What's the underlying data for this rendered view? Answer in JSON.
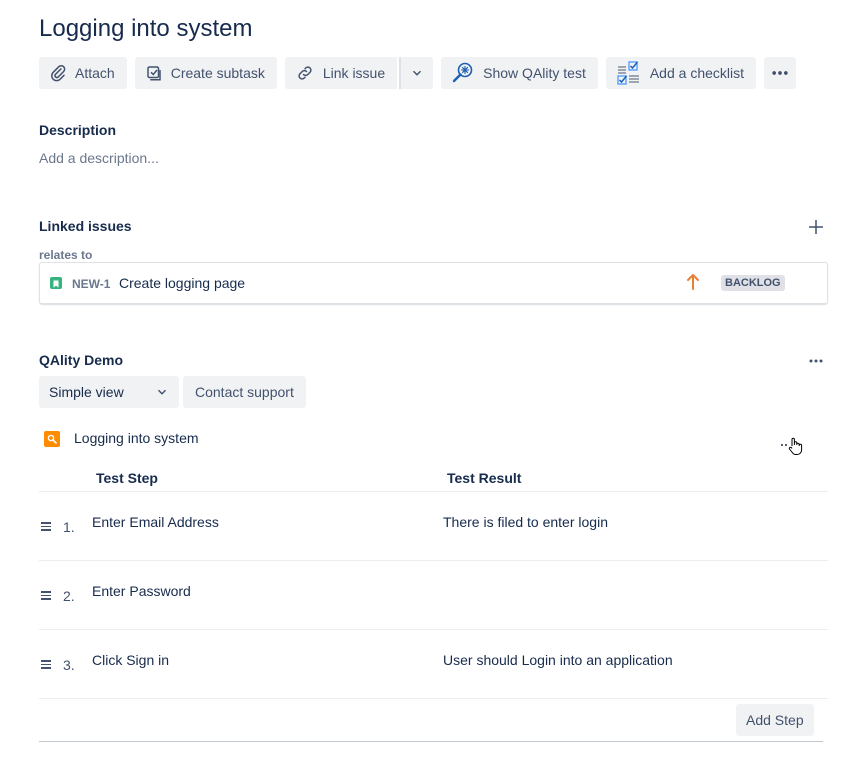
{
  "issue": {
    "title": "Logging into system"
  },
  "toolbar": {
    "attach": "Attach",
    "create_subtask": "Create subtask",
    "link_issue": "Link issue",
    "show_qality": "Show QAlity test",
    "add_checklist": "Add a checklist"
  },
  "description": {
    "label": "Description",
    "placeholder": "Add a description..."
  },
  "linked_issues": {
    "label": "Linked issues",
    "relation": "relates to",
    "items": [
      {
        "key": "NEW-1",
        "summary": "Create logging page",
        "status": "BACKLOG",
        "priority_color": "#ff7452"
      }
    ]
  },
  "qality": {
    "title": "QAlity Demo",
    "view_select": "Simple view",
    "contact_support": "Contact support",
    "test_name": "Logging into system",
    "columns": {
      "step": "Test Step",
      "result": "Test Result"
    },
    "steps": [
      {
        "num": "1.",
        "step": "Enter Email Address",
        "result": "There is filed to enter login"
      },
      {
        "num": "2.",
        "step": "Enter Password",
        "result": ""
      },
      {
        "num": "3.",
        "step": "Click Sign in",
        "result": "User should Login into an application"
      }
    ],
    "add_step": "Add Step"
  },
  "colors": {
    "accent_orange": "#ff8b00",
    "story_green": "#36b37e",
    "text": "#172b4d",
    "button_bg": "#f1f2f4"
  }
}
